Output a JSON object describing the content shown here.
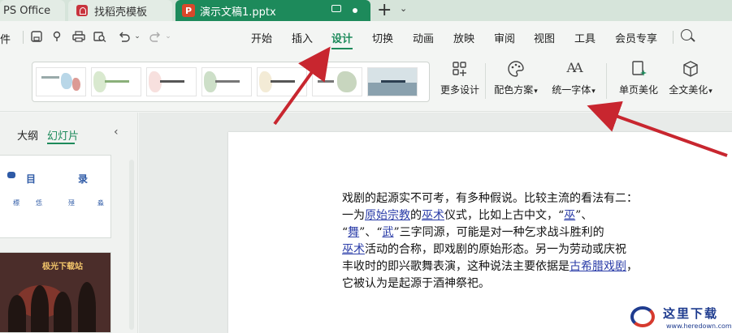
{
  "tabs": {
    "wps": "PS Office",
    "template": "找稻壳模板",
    "document": "演示文稿1.pptx",
    "ppt_logo": "P",
    "plus": "+",
    "chevron": "⌄"
  },
  "menu": {
    "file": "件",
    "items": [
      "开始",
      "插入",
      "设计",
      "切换",
      "动画",
      "放映",
      "审阅",
      "视图",
      "工具",
      "会员专享"
    ],
    "active": "设计"
  },
  "ribbon": {
    "buttons": [
      {
        "label": "更多设计",
        "icon": "grid-plus-icon"
      },
      {
        "label": "配色方案",
        "icon": "palette-icon",
        "dropdown": true
      },
      {
        "label": "统一字体",
        "icon": "font-aa-icon",
        "dropdown": true
      },
      {
        "label": "单页美化",
        "icon": "page-magic-icon"
      },
      {
        "label": "全文美化",
        "icon": "cube-icon",
        "dropdown": true
      }
    ],
    "dropdown_glyph": "▾",
    "font_glyph": "AA"
  },
  "left_panel": {
    "tab_outline": "大纲",
    "tab_slides": "幻灯片",
    "collapse": "‹",
    "slide1": {
      "title_left": "目",
      "title_right": "录",
      "items": [
        "標",
        "恁",
        "殛",
        "淼"
      ]
    },
    "slide2": {
      "title": "极光下载站"
    }
  },
  "slide": {
    "lines": [
      [
        {
          "t": "戏剧的起源实不可考，有多种假说。比较主流的看法有二："
        }
      ],
      [
        {
          "t": "一为"
        },
        {
          "t": "原始宗教",
          "link": true
        },
        {
          "t": "的"
        },
        {
          "t": "巫术",
          "link": true
        },
        {
          "t": "仪式，比如上古中文，“"
        },
        {
          "t": "巫",
          "link": true
        },
        {
          "t": "”、"
        }
      ],
      [
        {
          "t": "“"
        },
        {
          "t": "舞",
          "link": true
        },
        {
          "t": "”、“"
        },
        {
          "t": "武",
          "link": true
        },
        {
          "t": "”三字同源，可能是对一种乞求战斗胜利的"
        }
      ],
      [
        {
          "t": "巫术",
          "link": true
        },
        {
          "t": "活动的合称，即戏剧的原始形态。另一为劳动或庆祝"
        }
      ],
      [
        {
          "t": "丰收时的即兴歌舞表演，这种说法主要依据是"
        },
        {
          "t": "古希腊戏剧",
          "link": true
        },
        {
          "t": "，"
        }
      ],
      [
        {
          "t": "它被认为是起源于酒神祭祀。"
        }
      ]
    ]
  },
  "watermark": {
    "text": "这里下载",
    "url": "www.heredown.com"
  },
  "colors": {
    "accent": "#1d8a5b",
    "arrow": "#c8262f",
    "link": "#2b3da8"
  }
}
